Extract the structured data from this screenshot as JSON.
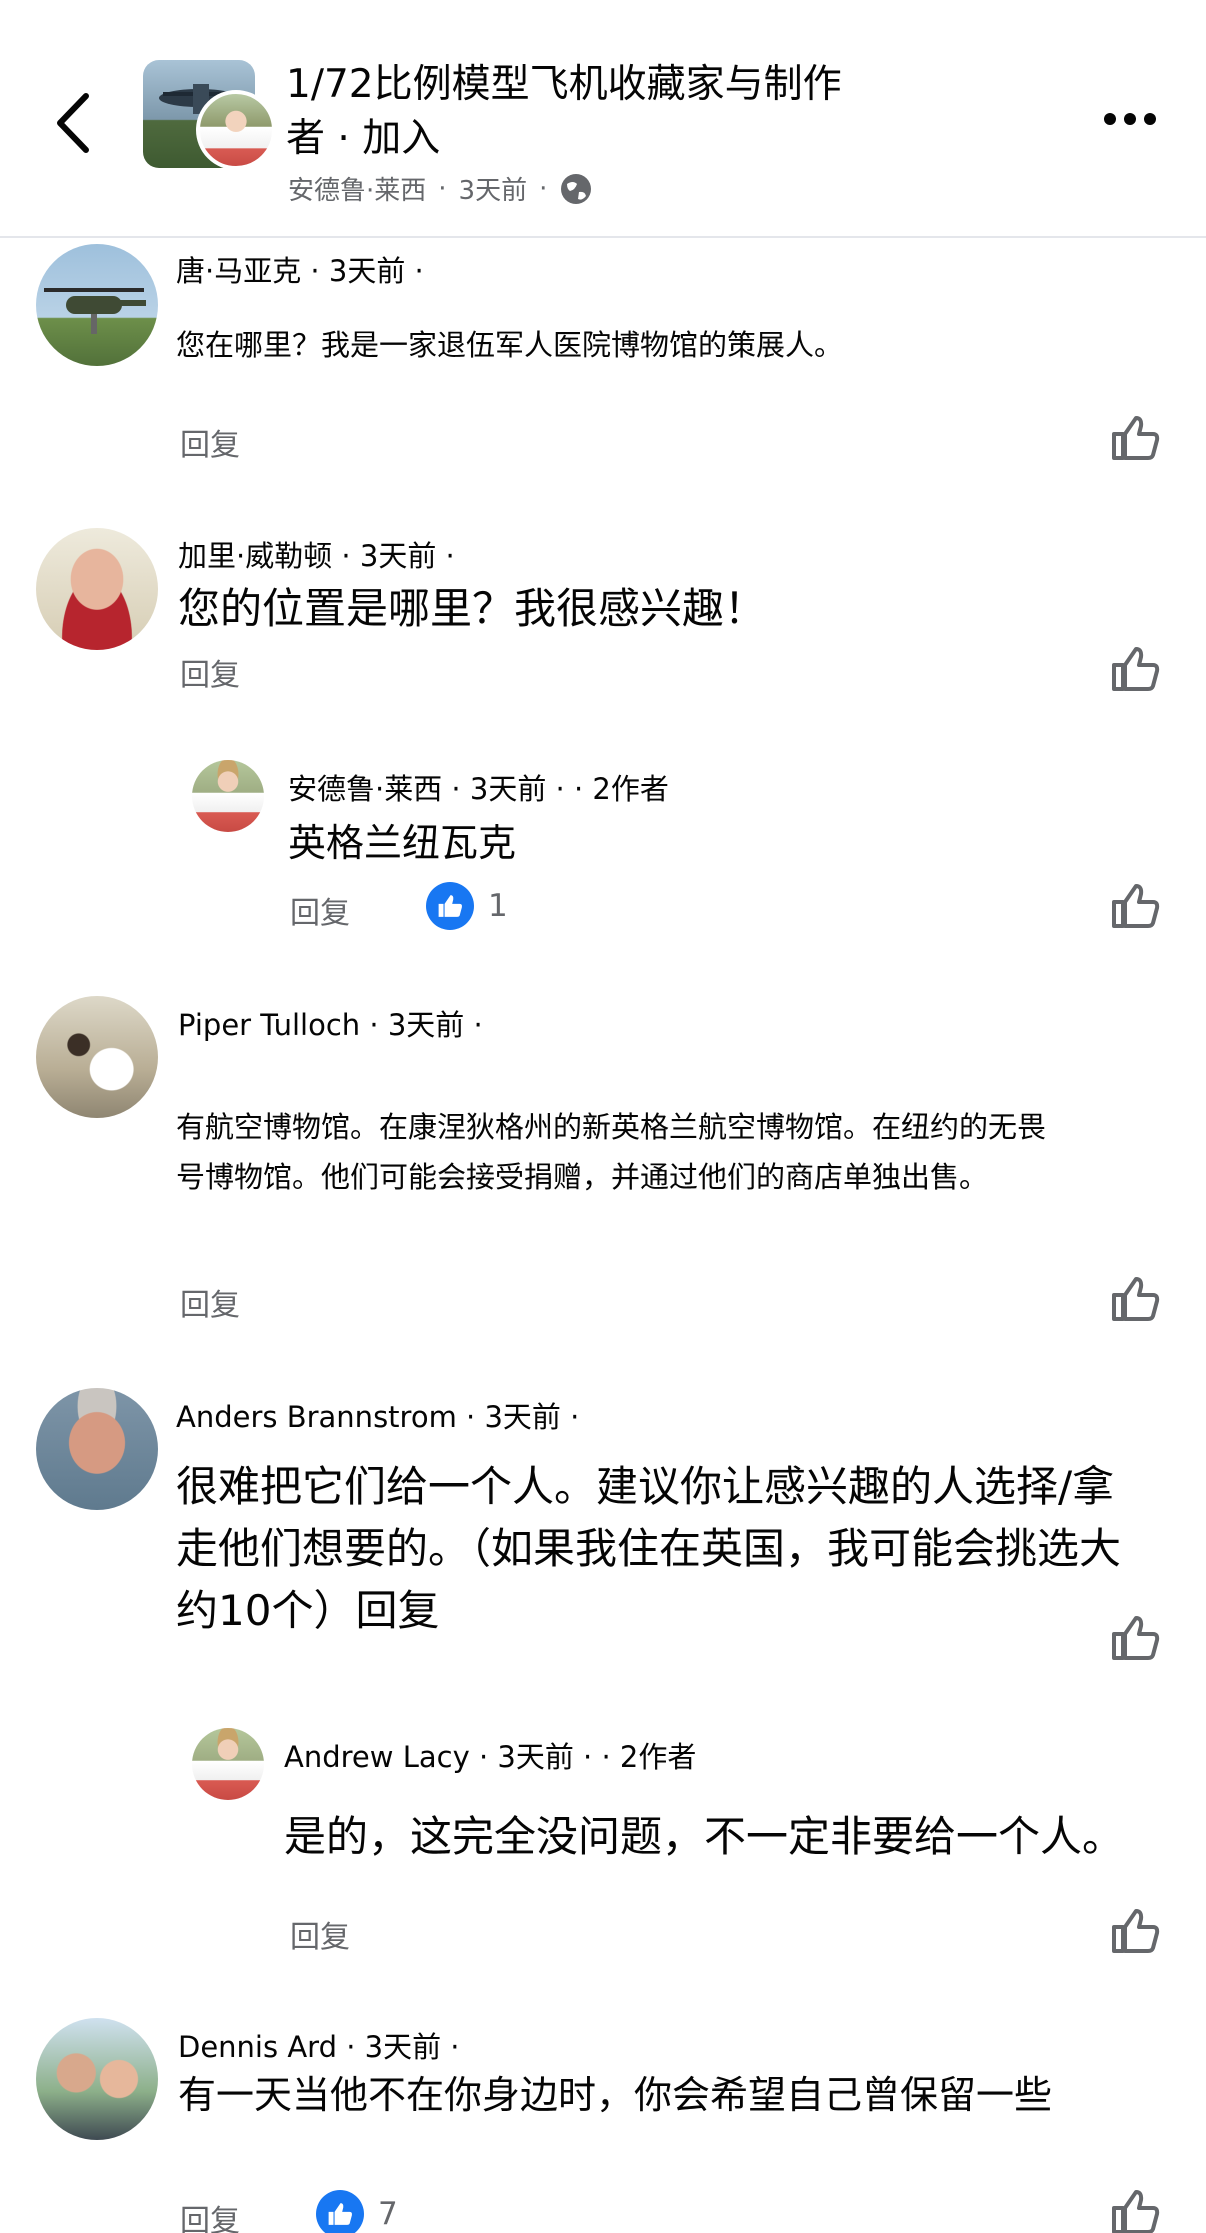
{
  "header": {
    "group_title": "1/72比例模型飞机收藏家与制作者",
    "join_separator": "·",
    "join_label": "加入",
    "meta_author": "安德鲁·莱西",
    "meta_time": "3天前",
    "meta_separator": "·"
  },
  "comments": [
    {
      "author": "唐·马亚克",
      "meta_suffix": " · 3天前 ·",
      "text": "您在哪里？我是一家退伍军人医院博物馆的策展人。",
      "reply_label": "回复"
    },
    {
      "author": "加里·威勒顿",
      "meta_suffix": " · 3天前 ·",
      "text": "您的位置是哪里？我很感兴趣！",
      "reply_label": "回复"
    },
    {
      "author": "安德鲁·莱西",
      "meta_suffix": " · 3天前 · · 2作者",
      "text": "英格兰纽瓦克",
      "reply_label": "回复",
      "reaction_count": "1"
    },
    {
      "author": "Piper Tulloch",
      "meta_suffix": " · 3天前 ·",
      "text_line1": "有航空博物馆。在康涅狄格州的新英格兰航空博物馆。在纽约的无畏",
      "text_line2": "号博物馆。他们可能会接受捐赠，并通过他们的商店单独出售。",
      "reply_label": "回复"
    },
    {
      "author": "Anders Brannstrom",
      "meta_suffix": " · 3天前 ·",
      "text_line1": "很难把它们给一个人。建议你让感兴趣的人选择/拿",
      "text_line2": "走他们想要的。（如果我住在英国，我可能会挑选大",
      "text_line3": "约10个）回复"
    },
    {
      "author": "Andrew Lacy",
      "meta_suffix": " · 3天前 · · 2作者",
      "text": "是的，这完全没问题，不一定非要给一个人。",
      "reply_label": "回复"
    },
    {
      "author": "Dennis Ard",
      "meta_suffix": " · 3天前 ·",
      "text": "有一天当他不在你身边时，你会希望自己曾保留一些",
      "reply_label": "回复",
      "reaction_count": "7"
    }
  ],
  "colors": {
    "text_primary": "#050505",
    "text_secondary": "#65676b",
    "like_blue": "#1877f2",
    "divider": "#e4e6eb"
  },
  "icons": [
    "back-arrow-icon",
    "more-icon",
    "globe-icon",
    "like-icon",
    "thumbs-up-reaction-icon"
  ]
}
